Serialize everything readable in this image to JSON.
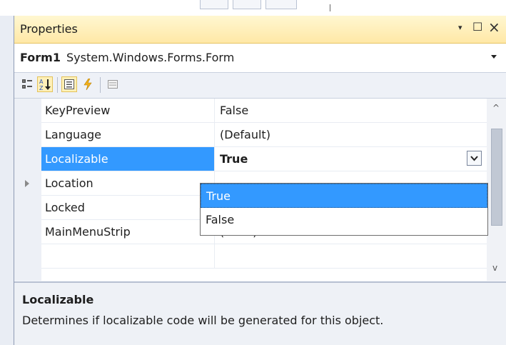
{
  "window": {
    "title": "Properties",
    "controls": {
      "dropdown_glyph": "▾",
      "maximize_glyph": "☐",
      "close_glyph": "×"
    }
  },
  "object_selector": {
    "name": "Form1",
    "type": "System.Windows.Forms.Form"
  },
  "toolbar": {
    "buttons": [
      {
        "icon": "categorized-icon",
        "selected": false
      },
      {
        "icon": "alphabetical-icon",
        "selected": true
      },
      {
        "icon": "properties-icon",
        "selected": true
      },
      {
        "icon": "events-icon",
        "selected": false
      },
      {
        "icon": "property-pages-icon",
        "selected": false
      }
    ]
  },
  "grid": {
    "rows": [
      {
        "name": "KeyPreview",
        "value": "False"
      },
      {
        "name": "Language",
        "value": "(Default)"
      },
      {
        "name": "Localizable",
        "value": "True",
        "selected": true
      },
      {
        "name": "Location",
        "value": "",
        "expandable": true
      },
      {
        "name": "Locked",
        "value": ""
      },
      {
        "name": "MainMenuStrip",
        "value": "(none)"
      }
    ]
  },
  "dropdown": {
    "options": [
      "True",
      "False"
    ],
    "highlighted": "True"
  },
  "description": {
    "title": "Localizable",
    "text": "Determines if localizable code will be generated for this object."
  },
  "colors": {
    "selection": "#3399ff",
    "titlebar": "#ffe8a6"
  }
}
